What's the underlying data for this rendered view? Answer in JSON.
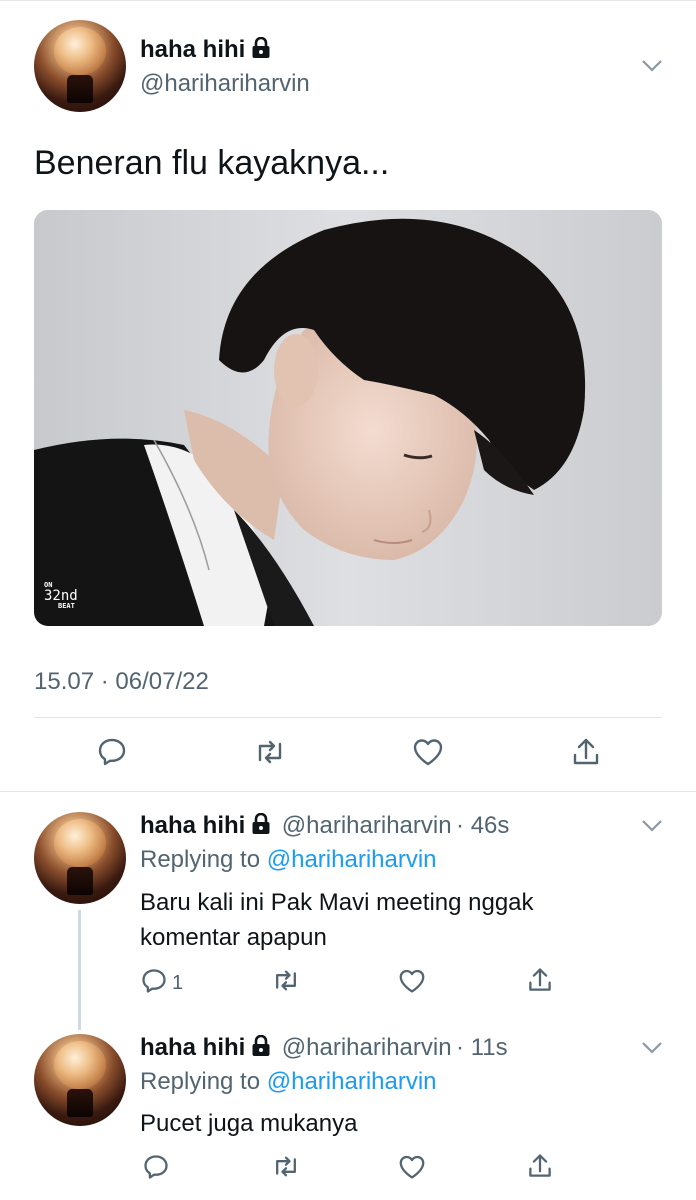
{
  "main_tweet": {
    "author_name": "haha hihi",
    "author_handle": "@harihariharvin",
    "text": "Beneran flu kayaknya...",
    "media_watermark": {
      "top": "ON",
      "middle": "32nd",
      "bottom": "BEAT"
    },
    "timestamp": "15.07 · 06/07/22"
  },
  "replies": [
    {
      "author_name": "haha hihi",
      "author_handle": "@harihariharvin",
      "time": "· 46s",
      "replying_prefix": "Replying to",
      "replying_to": "@harihariharvin",
      "text_line1": "Baru kali ini Pak Mavi meeting nggak",
      "text_line2": "komentar apapun",
      "reply_count": "1"
    },
    {
      "author_name": "haha hihi",
      "author_handle": "@harihariharvin",
      "time": "· 11s",
      "replying_prefix": "Replying to",
      "replying_to": "@harihariharvin",
      "text_line1": "Pucet juga mukanya"
    }
  ],
  "icons": {
    "reply": "speech-bubble-icon",
    "retweet": "retweet-icon",
    "like": "heart-icon",
    "share": "share-icon",
    "lock": "lock-icon",
    "more": "chevron-down-icon"
  },
  "colors": {
    "link": "#1d9bf0",
    "secondary_text": "#536471",
    "divider": "#e1e4e8"
  }
}
